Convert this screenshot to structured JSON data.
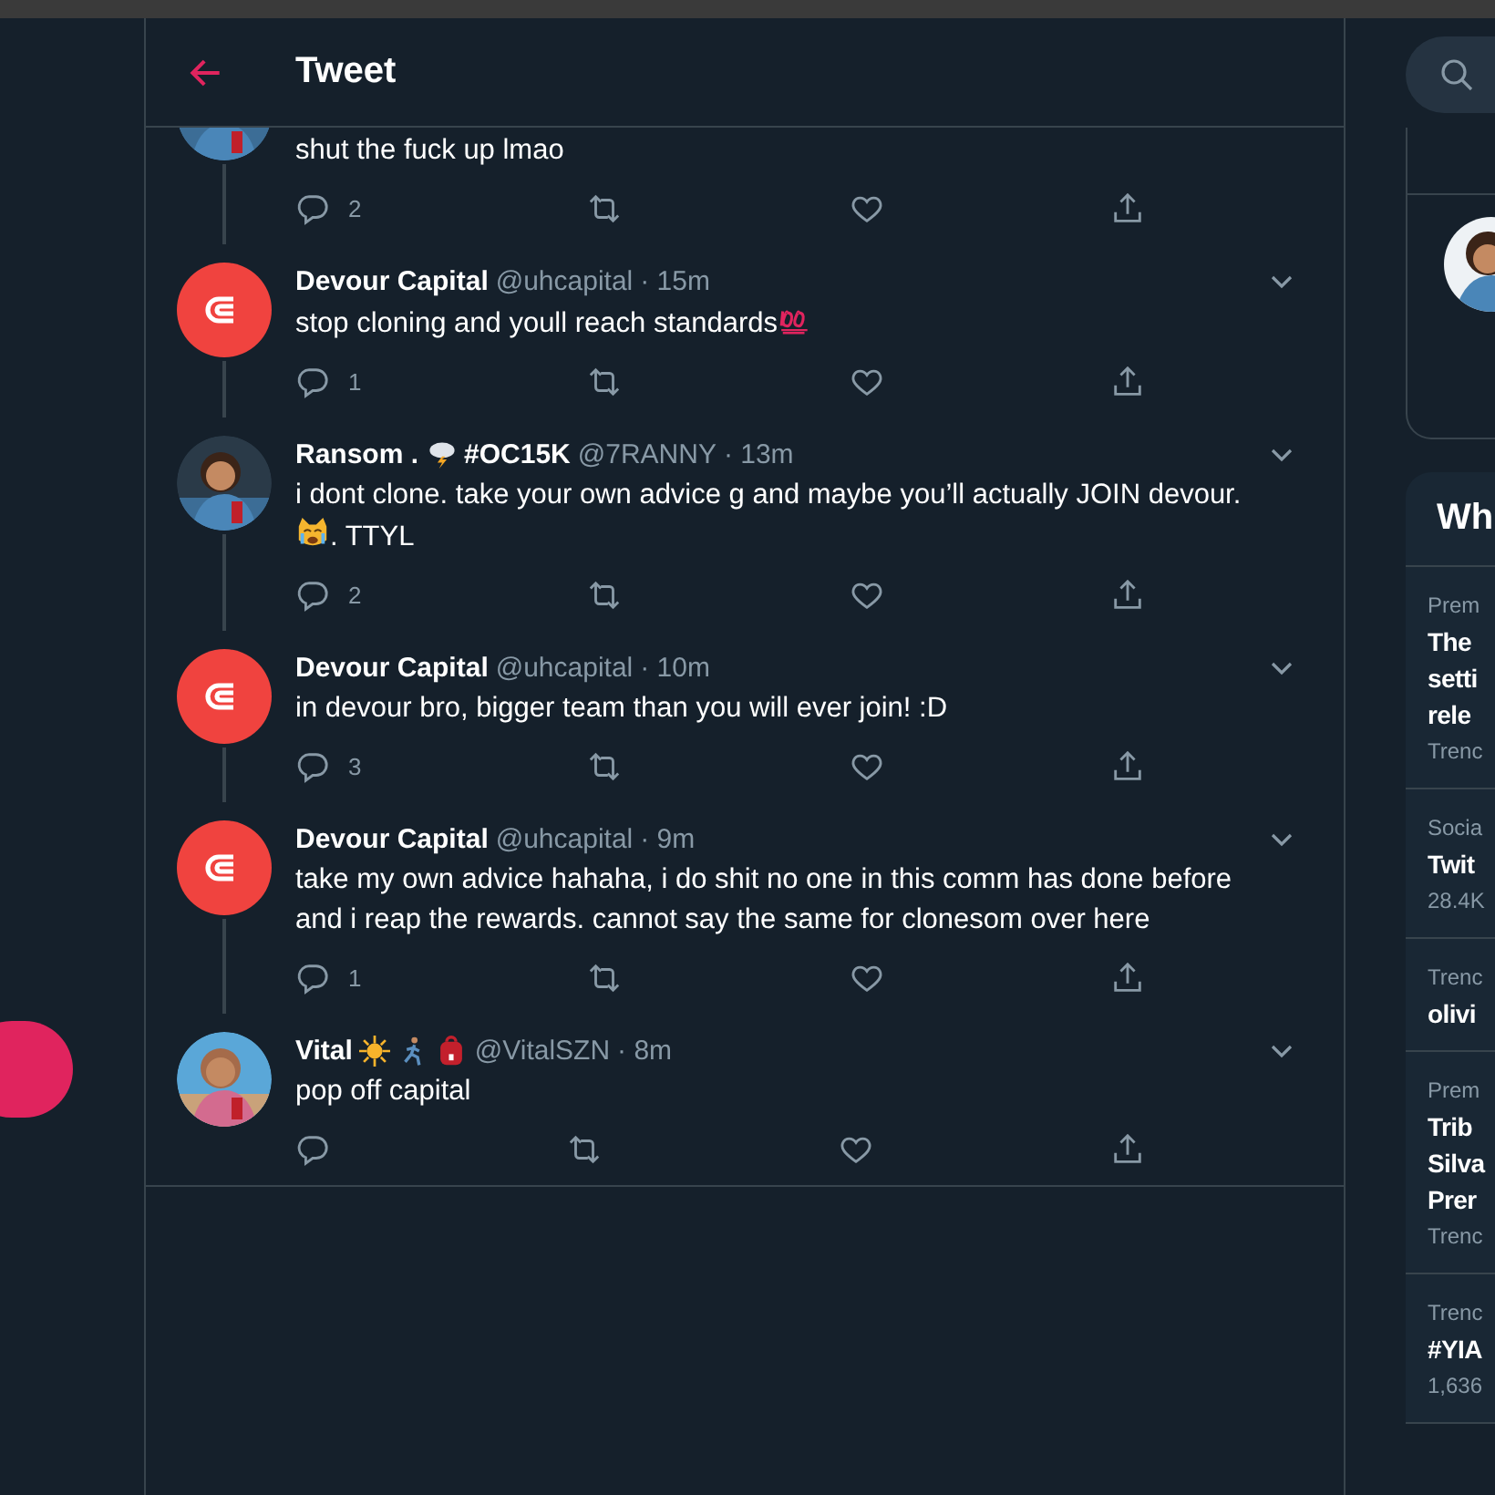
{
  "header": {
    "title": "Tweet"
  },
  "tweets": [
    {
      "partial": true,
      "text": "shut the fuck up lmao",
      "replies": "2",
      "menu": false
    },
    {
      "partial": false,
      "avatar": {
        "kind": "logo"
      },
      "name": "Devour Capital",
      "handle": "@uhcapital",
      "time": "· 15m",
      "text": "stop cloning and youll reach standards",
      "text_icons": [
        {
          "kind": "hundred"
        }
      ],
      "replies": "1",
      "menu": true
    },
    {
      "partial": false,
      "name": "Ransom .",
      "handle": "@7RANNY",
      "time": "· 13m",
      "name_icons": [
        {
          "kind": "storm"
        }
      ],
      "name_tail": "#OC15K",
      "text": "i dont clone. take your own advice g and maybe you’ll actually JOIN devour.",
      "text_icons": [
        {
          "kind": "cat"
        }
      ],
      "text_after": ". TTYL",
      "replies": "2",
      "menu": true
    },
    {
      "partial": false,
      "avatar": {
        "kind": "logo"
      },
      "name": "Devour Capital",
      "handle": "@uhcapital",
      "time": "· 10m",
      "text": "in devour bro, bigger team than you will ever join! :D",
      "replies": "3",
      "menu": true
    },
    {
      "partial": false,
      "avatar": {
        "kind": "logo"
      },
      "name": "Devour Capital",
      "handle": "@uhcapital",
      "time": "· 9m",
      "text": "take my own advice hahaha, i do shit no one in this comm has done before and i reap the rewards. cannot say the same for clonesom over here",
      "replies": "1",
      "menu": true
    },
    {
      "partial": false,
      "name": "Vital",
      "handle": "@VitalSZN",
      "time": "· 8m",
      "name_icons": [
        {
          "kind": "sun"
        },
        {
          "kind": "runner"
        },
        {
          "kind": "backpack"
        }
      ],
      "text": "pop off capital",
      "menu": true
    }
  ],
  "trends": {
    "heading": "Wh",
    "items": [
      {
        "category": "Prem",
        "title_lines": [
          "The",
          "setti",
          "rele"
        ],
        "meta": "Trenc"
      },
      {
        "category": "Socia",
        "title_lines": [
          "Twit"
        ],
        "meta": "28.4K"
      },
      {
        "category": "Trenc",
        "title_lines": [
          "olivi"
        ]
      },
      {
        "category": "Prem",
        "title_lines": [
          "Trib",
          "Silva",
          "Prer"
        ],
        "meta": "Trenc"
      },
      {
        "category": "Trenc",
        "title_lines": [
          "#YIA"
        ],
        "meta": "1,636"
      }
    ]
  }
}
